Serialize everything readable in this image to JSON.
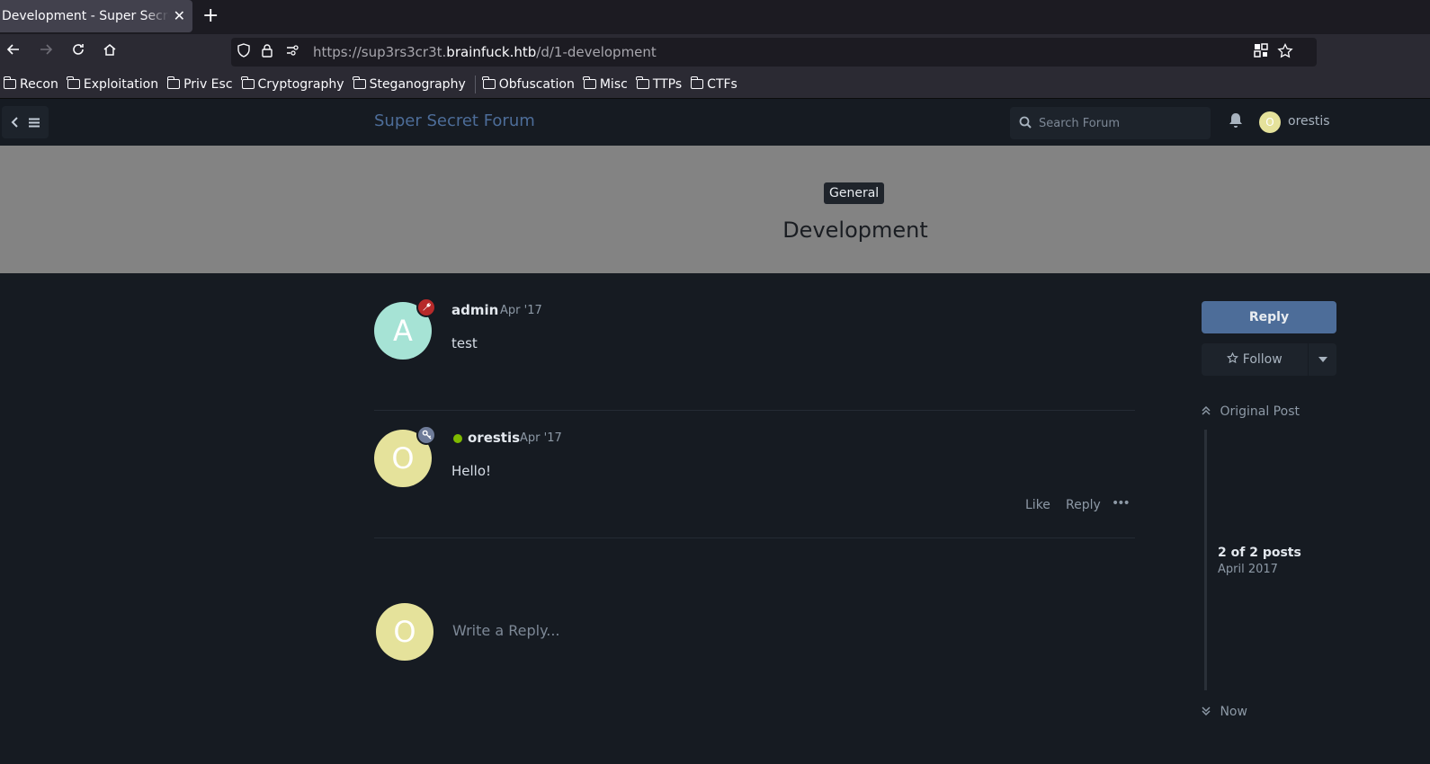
{
  "browser": {
    "tab_title": "Development - Super Secret Forum",
    "tab_close": "✕",
    "new_tab": "+",
    "url_prefix": "https://sup3rs3cr3t.",
    "url_host": "brainfuck.htb",
    "url_path": "/d/1-development",
    "bookmarks": [
      "Recon",
      "Exploitation",
      "Priv Esc",
      "Cryptography",
      "Steganography",
      "Obfuscation",
      "Misc",
      "TTPs",
      "CTFs"
    ]
  },
  "header": {
    "brand": "Super Secret Forum",
    "search_placeholder": "Search Forum",
    "user_initial": "O",
    "user_name": "orestis"
  },
  "hero": {
    "tag": "General",
    "title": "Development",
    "background": "#838383"
  },
  "posts": [
    {
      "initial": "A",
      "user": "admin",
      "date": "Apr '17",
      "body": "test",
      "avatar_color": "#a6e3d5",
      "badge_color": "#b72a2a",
      "badge_icon": "wrench-icon"
    },
    {
      "initial": "O",
      "user": "orestis",
      "date": "Apr '17",
      "body": "Hello!",
      "avatar_color": "#e5e29b",
      "badge_color": "#6f7c99",
      "badge_icon": "key-icon",
      "online": true
    }
  ],
  "post_actions": {
    "like": "Like",
    "reply": "Reply",
    "more": "•••"
  },
  "composer": {
    "initial": "O",
    "placeholder": "Write a Reply..."
  },
  "sidebar": {
    "reply_button": "Reply",
    "follow_button": "Follow",
    "scrubber_top": "Original Post",
    "scrubber_count": "2 of 2 posts",
    "scrubber_date": "April 2017",
    "scrubber_bottom": "Now"
  },
  "colors": {
    "accent": "#4d6d99",
    "page_bg": "#161b22",
    "online": "#7fba00"
  }
}
